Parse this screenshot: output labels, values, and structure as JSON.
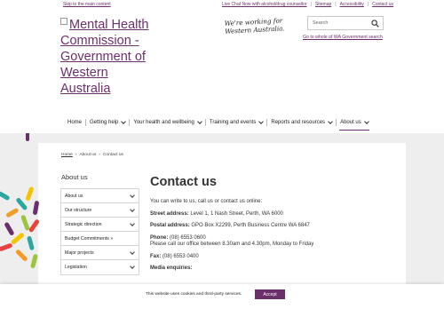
{
  "header": {
    "skip_link": "Skip to the main content",
    "utility_links": [
      "Live Chat Now with alcohol/drug counsellor",
      "Sitemap",
      "Accessibility",
      "Contact us"
    ],
    "logo_alt": "Mental Health Commission - Government of Western Australia",
    "tagline": "We're working for Western Australia.",
    "search_placeholder": "Search",
    "wa_gov_link": "Go to whole of WA Government search"
  },
  "nav": {
    "items": [
      {
        "label": "Home",
        "dropdown": false
      },
      {
        "label": "Getting help",
        "dropdown": true
      },
      {
        "label": "Your health and wellbeing",
        "dropdown": true
      },
      {
        "label": "Training and events",
        "dropdown": true
      },
      {
        "label": "Reports and resources",
        "dropdown": true
      },
      {
        "label": "About us",
        "dropdown": true,
        "active": true
      }
    ]
  },
  "breadcrumb": [
    "Home",
    "About us",
    "Contact us"
  ],
  "side_nav": {
    "title": "About us",
    "items": [
      {
        "label": "About us",
        "chevron": true
      },
      {
        "label": "Our structure",
        "chevron": true
      },
      {
        "label": "Strategic direction",
        "chevron": true
      },
      {
        "label": "Budget Commitments »",
        "chevron": false
      },
      {
        "label": "Major projects",
        "chevron": true
      },
      {
        "label": "Legislation",
        "chevron": true
      }
    ]
  },
  "content": {
    "title": "Contact us",
    "intro": "You can write to us, call us or contact us online:",
    "street_label": "Street address:",
    "street_value": "Level 1, 1 Nash Street, Perth, WA 6000",
    "postal_label": "Postal address:",
    "postal_value": "GPO Box X2299, Perth Business Centre WA 6847",
    "phone_label": "Phone:",
    "phone_value": "(08) 6553 0600",
    "phone_hours": "Please call our office between 8.30am and 4.30pm, Monday to Friday",
    "fax_label": "Fax:",
    "fax_value": "(08) 6553 0400",
    "media_label": "Media enquiries:"
  },
  "cookie": {
    "text": "This website uses cookies and third-party services.",
    "accept_label": "Accept"
  },
  "colors": {
    "brand_purple": "#6b2f6b",
    "band_grey": "#eeeeee"
  }
}
